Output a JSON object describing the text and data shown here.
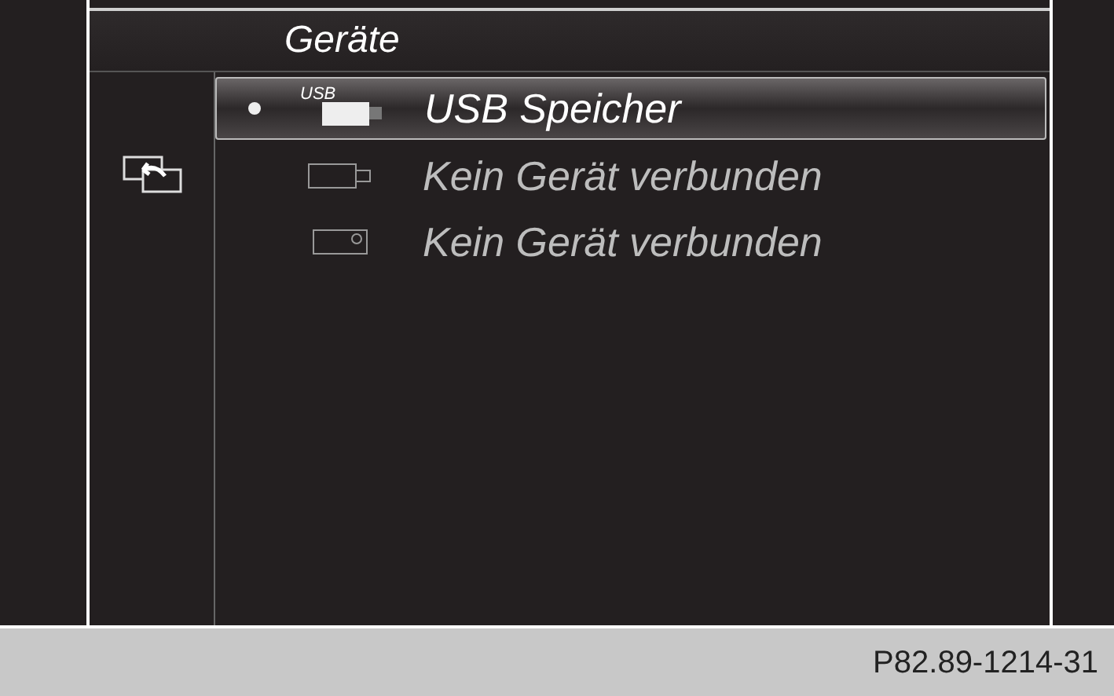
{
  "title": "Geräte",
  "devices": [
    {
      "kind": "usb",
      "icon_label": "USB",
      "label": "USB Speicher",
      "selected": true
    },
    {
      "kind": "usb_empty",
      "label": "Kein Gerät verbunden",
      "selected": false
    },
    {
      "kind": "card",
      "label": "Kein Gerät verbunden",
      "selected": false
    }
  ],
  "caption": "P82.89-1214-31"
}
